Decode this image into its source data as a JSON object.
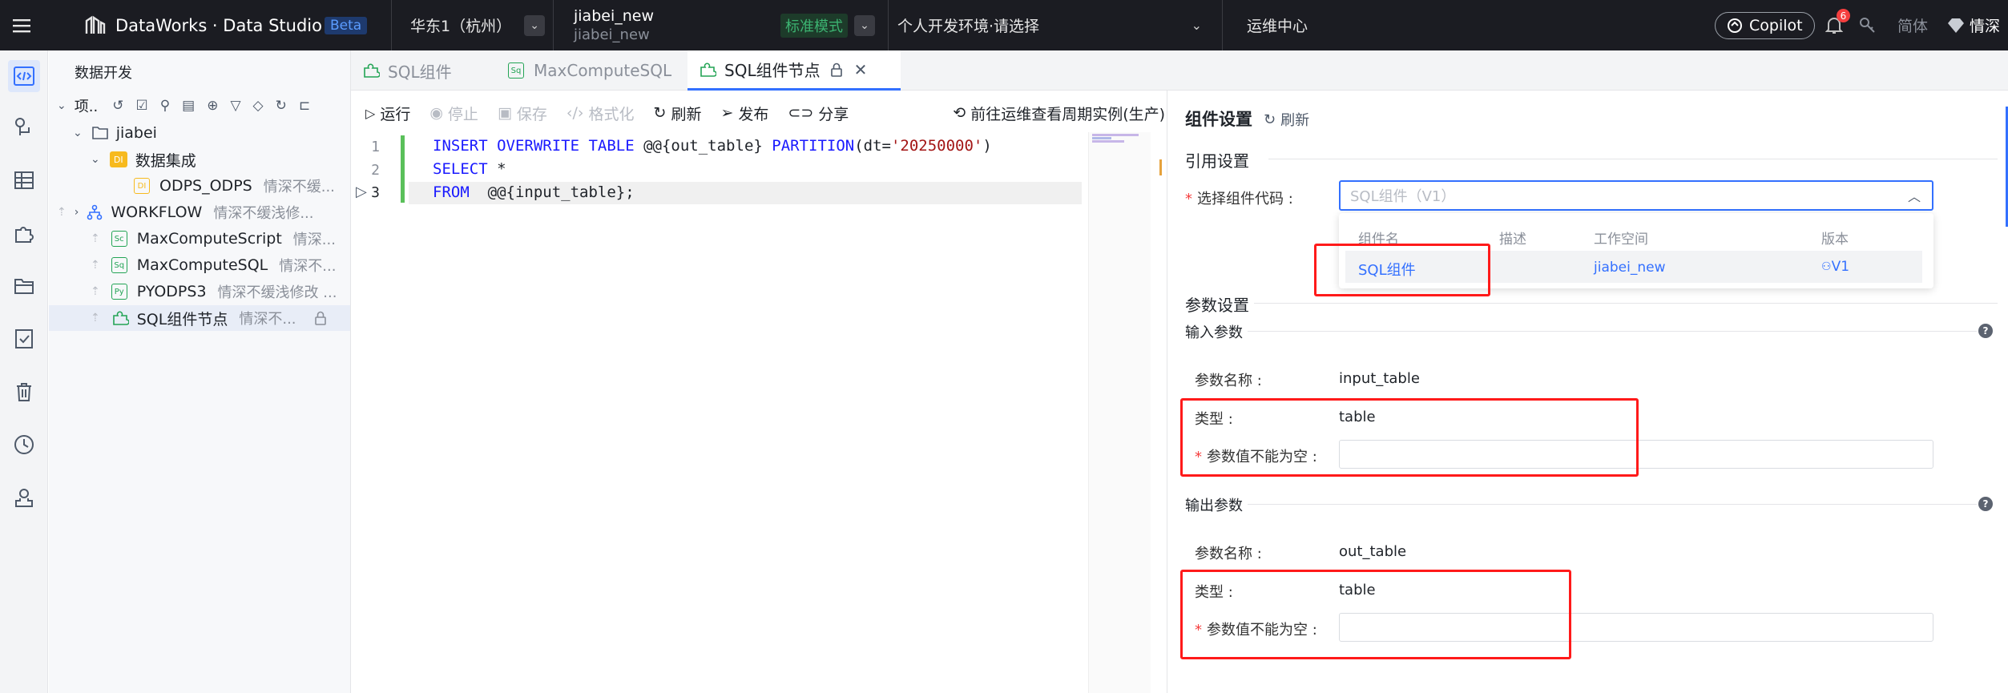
{
  "topbar": {
    "app_title": "DataWorks · Data Studio",
    "beta_badge": "Beta",
    "region": "华东1（杭州）",
    "workspace_name": "jiabei_new",
    "workspace_sub": "jiabei_new",
    "mode_badge": "标准模式",
    "dev_env": "个人开发环境·请选择",
    "ops_center": "运维中心",
    "copilot": "Copilot",
    "notification_count": "6",
    "lang": "简体",
    "user": "情深"
  },
  "tree": {
    "header": "数据开发",
    "root_label": "项..",
    "items": [
      {
        "label": "jiabei",
        "owner": ""
      },
      {
        "label": "数据集成",
        "owner": ""
      },
      {
        "label": "ODPS_ODPS",
        "owner": "情深不缓..."
      },
      {
        "label": "WORKFLOW",
        "owner": "情深不缓浅修..."
      },
      {
        "label": "MaxComputeScript",
        "owner": "情深..."
      },
      {
        "label": "MaxComputeSQL",
        "owner": "情深不..."
      },
      {
        "label": "PYODPS3",
        "owner": "情深不缓浅修改 ..."
      },
      {
        "label": "SQL组件节点",
        "owner": "情深不..."
      }
    ]
  },
  "tabs": [
    {
      "label": "SQL组件"
    },
    {
      "label": "MaxComputeSQL"
    },
    {
      "label": "SQL组件节点"
    }
  ],
  "toolbar": {
    "run": "运行",
    "stop": "停止",
    "save": "保存",
    "format": "格式化",
    "refresh": "刷新",
    "publish": "发布",
    "share": "分享",
    "goto_ops": "前往运维查看周期实例(生产)"
  },
  "editor": {
    "line_numbers": [
      "1",
      "2",
      "3"
    ],
    "line1": {
      "kw1": "INSERT OVERWRITE TABLE",
      "p1": " @@{out_table} ",
      "kw2": "PARTITION",
      "p2": "(dt=",
      "str": "'20250000'",
      "p3": ")"
    },
    "line2": {
      "kw": "SELECT",
      "rest": " *"
    },
    "line3": {
      "kw": "FROM",
      "rest": "  @@{input_table};"
    }
  },
  "panel": {
    "title": "组件设置",
    "refresh": "刷新",
    "ref_section": "引用设置",
    "select_label": "选择组件代码 :",
    "select_placeholder": "SQL组件（V1）",
    "dropdown_headers": [
      "组件名",
      "描述",
      "工作空间",
      "版本"
    ],
    "dropdown_row": {
      "name": "SQL组件",
      "desc": "",
      "workspace": "jiabei_new",
      "version": "V1"
    },
    "param_section": "参数设置",
    "input_params": "输入参数",
    "in_name_label": "参数名称 :",
    "in_name_value": "input_table",
    "in_type_label": "类型 :",
    "in_type_value": "table",
    "in_value_label": "参数值不能为空 :",
    "output_params": "输出参数",
    "out_name_label": "参数名称 :",
    "out_name_value": "out_table",
    "out_type_label": "类型 :",
    "out_type_value": "table",
    "out_value_label": "参数值不能为空 :"
  }
}
